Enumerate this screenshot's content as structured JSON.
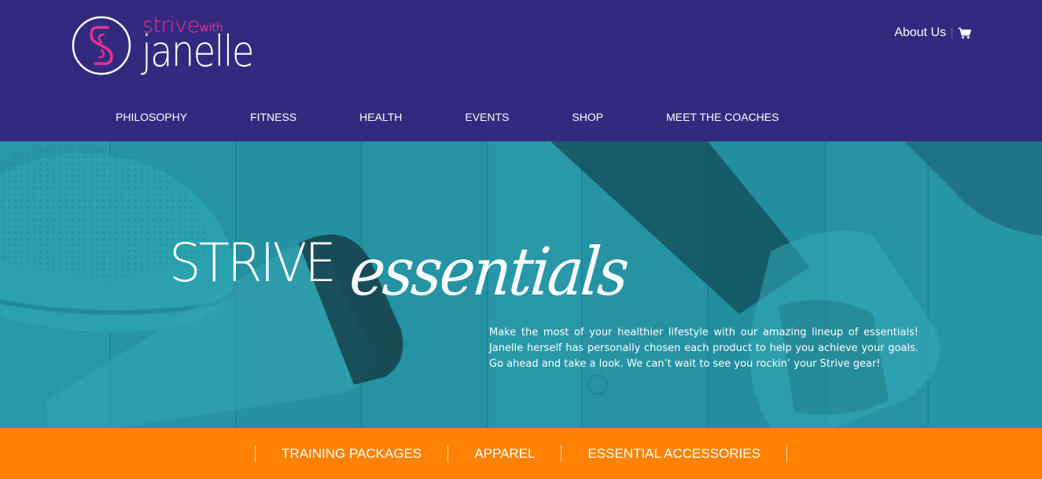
{
  "brand": {
    "strive": "strive",
    "with": "with",
    "name": "janelle",
    "pink": "#e8318a",
    "purple": "#332a80"
  },
  "utility": {
    "about_label": "About Us",
    "cart_icon": "shopping-cart-icon"
  },
  "main_nav": [
    {
      "label": "PHILOSOPHY"
    },
    {
      "label": "FITNESS"
    },
    {
      "label": "HEALTH"
    },
    {
      "label": "EVENTS"
    },
    {
      "label": "SHOP"
    },
    {
      "label": "MEET THE COACHES"
    }
  ],
  "hero": {
    "title_part1": "STRIVE",
    "title_part2": "essentials",
    "body": "Make the most of your healthier lifestyle with our amazing lineup of essentials! Janelle herself has personally chosen each product to help you achieve your goals. Go ahead and take a look. We can’t wait to see you rockin’ your Strive gear!",
    "overlay_color": "#2794a4"
  },
  "sub_nav": {
    "background": "#ff8205",
    "items": [
      {
        "label": "TRAINING PACKAGES"
      },
      {
        "label": "APPAREL"
      },
      {
        "label": "ESSENTIAL ACCESSORIES"
      }
    ]
  }
}
